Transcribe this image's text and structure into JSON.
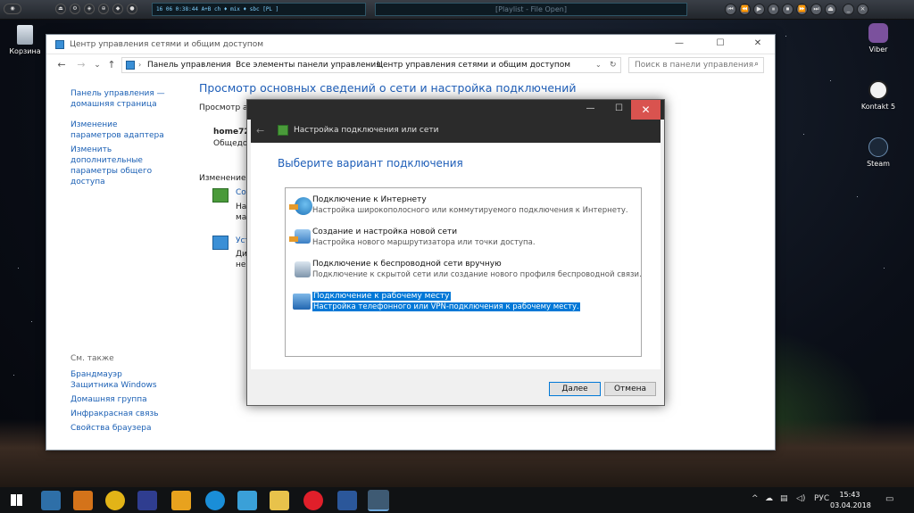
{
  "player": {
    "lcd_text": "16   06   0:38:44   A+B ch  ♦   mix  ♦   sbc  [PL ]",
    "title": "[Playlist - File Open]"
  },
  "desktop": {
    "icons": [
      {
        "label": "Корзина"
      },
      {
        "label": "Viber"
      },
      {
        "label": "Kontakt 5"
      },
      {
        "label": "Steam"
      }
    ]
  },
  "window": {
    "title": "Центр управления сетями и общим доступом",
    "minimize": "—",
    "maximize": "☐",
    "close": "✕",
    "breadcrumb": [
      "Панель управления",
      "Все элементы панели управления",
      "Центр управления сетями и общим доступом"
    ],
    "search_placeholder": "Поиск в панели управления",
    "sidebar": {
      "home_link": "Панель управления — домашняя страница",
      "links": [
        "Изменение параметров адаптера",
        "Изменить дополнительные параметры общего доступа"
      ],
      "see_also_title": "См. также",
      "see_also": [
        "Брандмауэр Защитника Windows",
        "Домашняя группа",
        "Инфракрасная связь",
        "Свойства браузера"
      ]
    },
    "main": {
      "heading": "Просмотр основных сведений о сети и настройка подключений",
      "active_networks_label": "Просмотр ак",
      "network_name": "home72",
      "network_type": "Общедос",
      "change_settings_label": "Изменение с",
      "item1_title": "Соз",
      "item1_desc_1": "Нас",
      "item1_desc_2": "мар",
      "item2_title": "Уст",
      "item2_desc_1": "Диа",
      "item2_desc_2": "неп"
    }
  },
  "dialog": {
    "title": "Настройка подключения или сети",
    "minimize": "—",
    "maximize": "☐",
    "close": "✕",
    "heading": "Выберите вариант подключения",
    "options": [
      {
        "title": "Подключение к Интернету",
        "desc": "Настройка широкополосного или коммутируемого подключения к Интернету."
      },
      {
        "title": "Создание и настройка новой сети",
        "desc": "Настройка нового маршрутизатора или точки доступа."
      },
      {
        "title": "Подключение к беспроводной сети вручную",
        "desc": "Подключение к скрытой сети или создание нового профиля беспроводной связи."
      },
      {
        "title": "Подключение к рабочему месту",
        "desc": "Настройка телефонного или VPN-подключения к рабочему месту."
      }
    ],
    "selected_index": 3,
    "next_label": "Далее",
    "cancel_label": "Отмена"
  },
  "taskbar": {
    "language": "РУС",
    "time": "15:43",
    "date": "03.04.2018"
  }
}
